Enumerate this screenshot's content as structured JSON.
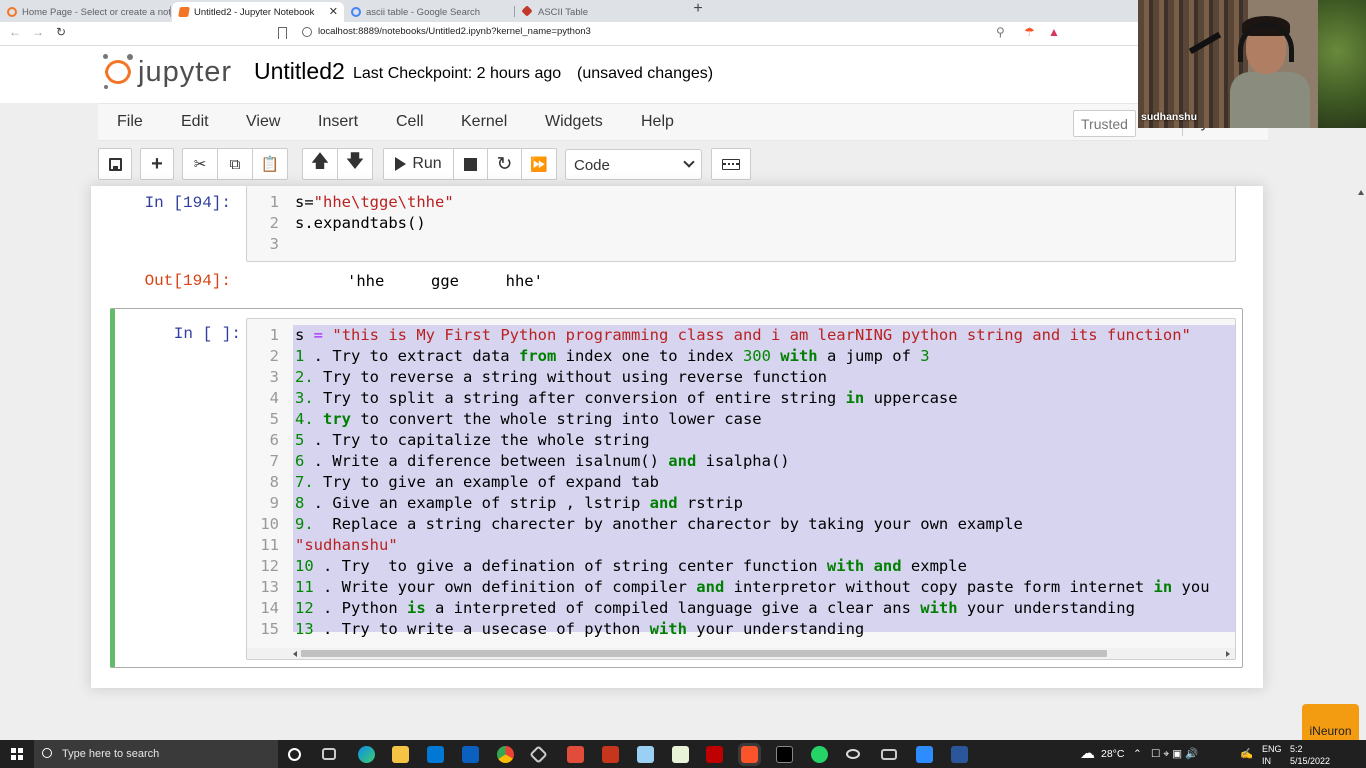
{
  "browser": {
    "tabs": [
      {
        "title": "Home Page - Select or create a notebook",
        "active": false
      },
      {
        "title": "Untitled2 - Jupyter Notebook",
        "active": true
      },
      {
        "title": "ascii table - Google Search",
        "active": false
      },
      {
        "title": "ASCII Table",
        "active": false
      }
    ],
    "url": "localhost:8889/notebooks/Untitled2.ipynb?kernel_name=python3",
    "new_tab_glyph": "+"
  },
  "header": {
    "logo_text": "jupyter",
    "notebook_name": "Untitled2",
    "checkpoint": "Last Checkpoint: 2 hours ago",
    "unsaved": "(unsaved changes)"
  },
  "menubar": {
    "items": [
      "File",
      "Edit",
      "View",
      "Insert",
      "Cell",
      "Kernel",
      "Widgets",
      "Help"
    ],
    "trusted": "Trusted",
    "kernel": "Python"
  },
  "toolbar": {
    "run_label": "Run",
    "cell_type": "Code",
    "icons": [
      "save-icon",
      "plus-icon",
      "scissors-icon",
      "copy-icon",
      "paste-icon",
      "arrow-up-icon",
      "arrow-down-icon",
      "run-icon",
      "stop-icon",
      "restart-icon",
      "fast-forward-icon",
      "keyboard-icon"
    ]
  },
  "cells": {
    "c1": {
      "prompt": "In [194]:",
      "out_prompt": "Out[194]:",
      "output": "'hhe     gge     hhe'",
      "line_numbers": [
        "1",
        "2",
        "3"
      ],
      "lines": [
        "s=\"hhe\\tgge\\thhe\"",
        "s.expandtabs()",
        ""
      ]
    },
    "c2": {
      "prompt": "In [ ]:",
      "line_numbers": [
        "1",
        "2",
        "3",
        "4",
        "5",
        "6",
        "7",
        "8",
        "9",
        "10",
        "11",
        "12",
        "13",
        "14",
        "15"
      ]
    }
  },
  "webcam": {
    "name": "sudhanshu"
  },
  "taskbar": {
    "search_placeholder": "Type here to search",
    "weather": "28°C",
    "lang": "ENG",
    "lang_sub": "IN",
    "time": "5:2",
    "date": "5/15/2022"
  },
  "overlay": {
    "brand": "iNeuron"
  }
}
